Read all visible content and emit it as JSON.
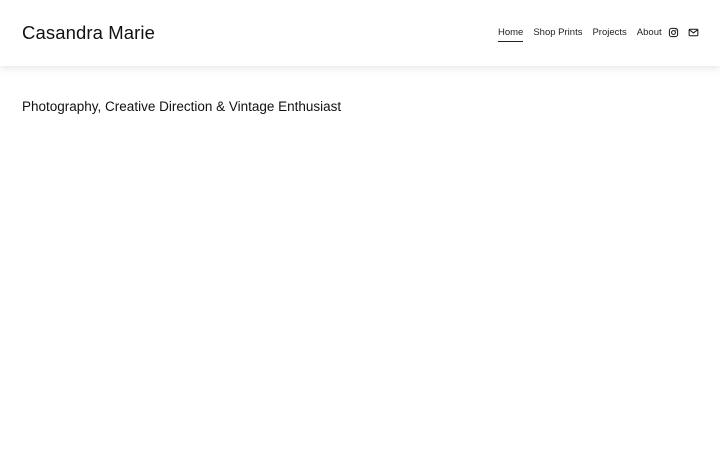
{
  "header": {
    "site_title": "Casandra Marie",
    "nav": [
      {
        "label": "Home",
        "active": true
      },
      {
        "label": "Shop Prints",
        "active": false
      },
      {
        "label": "Projects",
        "active": false
      },
      {
        "label": "About",
        "active": false
      }
    ],
    "social": [
      {
        "icon": "instagram-icon"
      },
      {
        "icon": "email-icon"
      }
    ]
  },
  "main": {
    "tagline": "Photography, Creative Direction & Vintage Enthusiast"
  },
  "colors": {
    "background": "#ffffff",
    "text": "#111111"
  }
}
